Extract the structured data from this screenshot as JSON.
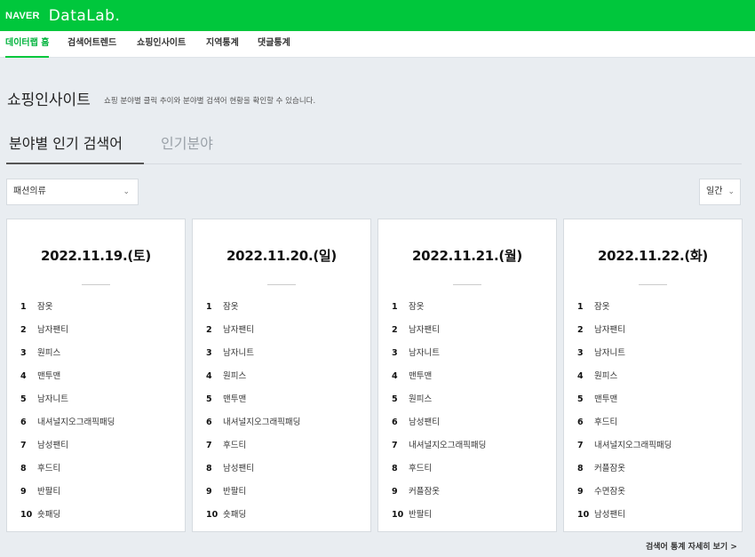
{
  "header": {
    "brand": "NAVER",
    "product": "DataLab."
  },
  "nav": [
    {
      "label": "데이터랩 홈",
      "active": true
    },
    {
      "label": "검색어트렌드",
      "active": false
    },
    {
      "label": "쇼핑인사이트",
      "active": false
    },
    {
      "label": "지역통계",
      "active": false
    },
    {
      "label": "댓글통계",
      "active": false
    }
  ],
  "page": {
    "title": "쇼핑인사이트",
    "description": "쇼핑 분야별 클릭 추이와 분야별 검색어 현황을 확인할 수 있습니다."
  },
  "tabs": [
    {
      "label": "분야별 인기 검색어",
      "active": true
    },
    {
      "label": "인기분야",
      "active": false
    }
  ],
  "filters": {
    "category": "패션의류",
    "period": "일간"
  },
  "cards": [
    {
      "date": "2022.11.19.(토)",
      "items": [
        {
          "rank": "1",
          "term": "잠옷"
        },
        {
          "rank": "2",
          "term": "남자팬티"
        },
        {
          "rank": "3",
          "term": "원피스"
        },
        {
          "rank": "4",
          "term": "맨투맨"
        },
        {
          "rank": "5",
          "term": "남자니트"
        },
        {
          "rank": "6",
          "term": "내셔널지오그래픽패딩"
        },
        {
          "rank": "7",
          "term": "남성팬티"
        },
        {
          "rank": "8",
          "term": "후드티"
        },
        {
          "rank": "9",
          "term": "반팔티"
        },
        {
          "rank": "10",
          "term": "숏패딩"
        }
      ]
    },
    {
      "date": "2022.11.20.(일)",
      "items": [
        {
          "rank": "1",
          "term": "잠옷"
        },
        {
          "rank": "2",
          "term": "남자팬티"
        },
        {
          "rank": "3",
          "term": "남자니트"
        },
        {
          "rank": "4",
          "term": "원피스"
        },
        {
          "rank": "5",
          "term": "맨투맨"
        },
        {
          "rank": "6",
          "term": "내셔널지오그래픽패딩"
        },
        {
          "rank": "7",
          "term": "후드티"
        },
        {
          "rank": "8",
          "term": "남성팬티"
        },
        {
          "rank": "9",
          "term": "반팔티"
        },
        {
          "rank": "10",
          "term": "숏패딩"
        }
      ]
    },
    {
      "date": "2022.11.21.(월)",
      "items": [
        {
          "rank": "1",
          "term": "잠옷"
        },
        {
          "rank": "2",
          "term": "남자팬티"
        },
        {
          "rank": "3",
          "term": "남자니트"
        },
        {
          "rank": "4",
          "term": "맨투맨"
        },
        {
          "rank": "5",
          "term": "원피스"
        },
        {
          "rank": "6",
          "term": "남성팬티"
        },
        {
          "rank": "7",
          "term": "내셔널지오그래픽패딩"
        },
        {
          "rank": "8",
          "term": "후드티"
        },
        {
          "rank": "9",
          "term": "커플잠옷"
        },
        {
          "rank": "10",
          "term": "반팔티"
        }
      ]
    },
    {
      "date": "2022.11.22.(화)",
      "items": [
        {
          "rank": "1",
          "term": "잠옷"
        },
        {
          "rank": "2",
          "term": "남자팬티"
        },
        {
          "rank": "3",
          "term": "남자니트"
        },
        {
          "rank": "4",
          "term": "원피스"
        },
        {
          "rank": "5",
          "term": "맨투맨"
        },
        {
          "rank": "6",
          "term": "후드티"
        },
        {
          "rank": "7",
          "term": "내셔널지오그래픽패딩"
        },
        {
          "rank": "8",
          "term": "커플잠옷"
        },
        {
          "rank": "9",
          "term": "수면잠옷"
        },
        {
          "rank": "10",
          "term": "남성팬티"
        }
      ]
    }
  ],
  "footer": {
    "more_link": "검색어 통계 자세히 보기 >"
  },
  "colors": {
    "brand_green": "#00c73c",
    "background": "#e9edf1"
  }
}
